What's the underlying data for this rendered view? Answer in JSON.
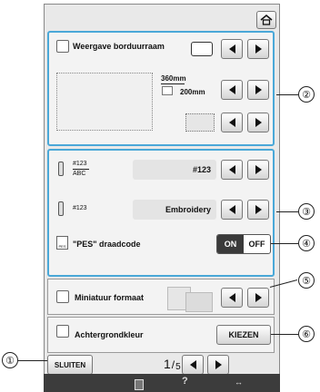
{
  "header": {
    "home_icon": "home-icon"
  },
  "frame_display": {
    "label": "Weergave borduurraam",
    "width_text": "360mm",
    "height_text": "200mm"
  },
  "thread": {
    "row1_code_top": "#123",
    "row1_code_bottom": "ABC",
    "row1_value": "#123",
    "row2_code": "#123",
    "row2_value": "Embroidery",
    "pes_label": "\"PES\" draadcode",
    "on_label": "ON",
    "off_label": "OFF"
  },
  "thumbnail": {
    "label": "Miniatuur formaat"
  },
  "background": {
    "label": "Achtergrondkleur",
    "button_label": "KIEZEN"
  },
  "footer": {
    "close_label": "SLUITEN",
    "page_current": "1",
    "page_total": "5"
  },
  "callouts": [
    "①",
    "②",
    "③",
    "④",
    "⑤",
    "⑥"
  ]
}
